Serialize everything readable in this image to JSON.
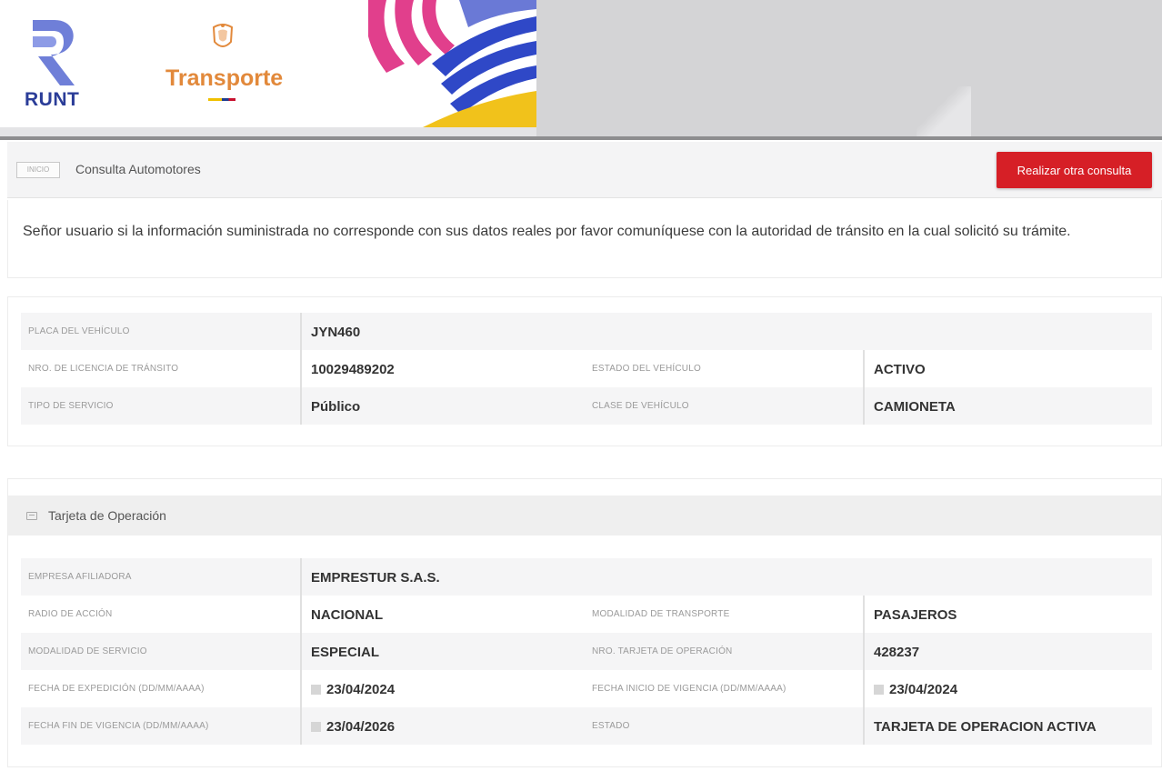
{
  "header": {
    "runt_logo_text": "RUNT",
    "transporte_logo_text": "Transporte"
  },
  "toolbar": {
    "badge_text": "INICIO",
    "title": "Consulta Automotores",
    "new_query_button": "Realizar otra consulta",
    "button_color": "#d61f26"
  },
  "notice": {
    "text": "Señor usuario si la información suministrada no corresponde con sus datos reales por favor comuníquese con la autoridad de tránsito en la cual solicitó su trámite."
  },
  "vehicle": {
    "plate_label": "PLACA DEL VEHÍCULO",
    "plate_value": "JYN460",
    "license_label": "NRO. DE LICENCIA DE TRÁNSITO",
    "license_value": "10029489202",
    "status_label": "ESTADO DEL VEHÍCULO",
    "status_value": "ACTIVO",
    "service_label": "TIPO DE SERVICIO",
    "service_value": "Público",
    "class_label": "CLASE DE VEHÍCULO",
    "class_value": "CAMIONETA"
  },
  "operation_card": {
    "section_title": "Tarjeta de Operación",
    "company_label": "EMPRESA AFILIADORA",
    "company_value": "EMPRESTUR S.A.S.",
    "radius_label": "RADIO DE ACCIÓN",
    "radius_value": "NACIONAL",
    "transport_mode_label": "MODALIDAD DE TRANSPORTE",
    "transport_mode_value": "PASAJEROS",
    "service_mode_label": "MODALIDAD DE SERVICIO",
    "service_mode_value": "ESPECIAL",
    "card_number_label": "NRO. TARJETA DE OPERACIÓN",
    "card_number_value": "428237",
    "issue_date_label": "FECHA DE EXPEDICIÓN (DD/MM/AAAA)",
    "issue_date_value": "23/04/2024",
    "validity_start_label": "FECHA INICIO DE VIGENCIA (DD/MM/AAAA)",
    "validity_start_value": "23/04/2024",
    "validity_end_label": "FECHA FIN DE VIGENCIA (DD/MM/AAAA)",
    "validity_end_value": "23/04/2026",
    "state_label": "ESTADO",
    "state_value": "TARJETA DE OPERACION ACTIVA"
  }
}
